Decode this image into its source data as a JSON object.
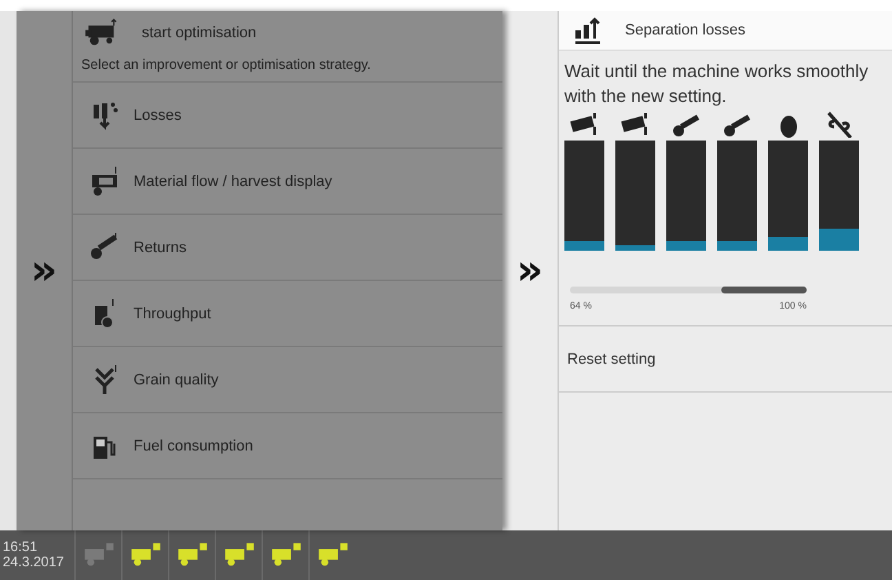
{
  "left_panel": {
    "expand_glyph": "»",
    "header": {
      "title": "start optimisation"
    },
    "instruction": "Select an improvement or optimisation strategy.",
    "items": [
      {
        "label": "Losses"
      },
      {
        "label": "Material flow / harvest display"
      },
      {
        "label": "Returns"
      },
      {
        "label": "Throughput"
      },
      {
        "label": "Grain quality"
      },
      {
        "label": "Fuel consumption"
      }
    ]
  },
  "right_panel": {
    "expand_glyph": "»",
    "header": {
      "title": "Separation losses"
    },
    "message": "Wait until the machine works smoothly with the new setting.",
    "bars": [
      {
        "level": 0.09
      },
      {
        "level": 0.05
      },
      {
        "level": 0.09
      },
      {
        "level": 0.09
      },
      {
        "level": 0.13
      },
      {
        "level": 0.2
      }
    ],
    "range": {
      "level": 0.36,
      "min_label": "64 %",
      "max_label": "100 %"
    },
    "actions": [
      "Reset setting"
    ]
  },
  "status_bar": {
    "time": "16:51",
    "date": "24.3.2017",
    "tabs": [
      {
        "disabled": true
      },
      {
        "disabled": false
      },
      {
        "disabled": false
      },
      {
        "disabled": false
      },
      {
        "disabled": false
      },
      {
        "disabled": false
      }
    ]
  }
}
